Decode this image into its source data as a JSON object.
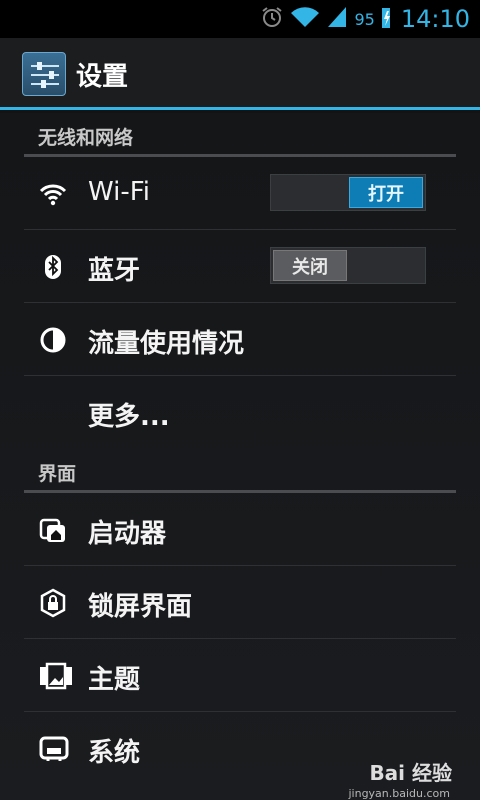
{
  "status_bar": {
    "battery": "95",
    "time": "14:10"
  },
  "action_bar": {
    "title": "设置"
  },
  "sections": [
    {
      "label": "无线和网络",
      "items": [
        {
          "label": "Wi-Fi",
          "icon": "wifi-icon",
          "toggle": "打开",
          "toggle_state": "on"
        },
        {
          "label": "蓝牙",
          "icon": "bluetooth-icon",
          "toggle": "关闭",
          "toggle_state": "off"
        },
        {
          "label": "流量使用情况",
          "icon": "data-usage-icon"
        },
        {
          "label": "更多...",
          "icon": ""
        }
      ]
    },
    {
      "label": "界面",
      "items": [
        {
          "label": "启动器",
          "icon": "launcher-icon"
        },
        {
          "label": "锁屏界面",
          "icon": "lockscreen-icon"
        },
        {
          "label": "主题",
          "icon": "theme-icon"
        },
        {
          "label": "系统",
          "icon": "system-icon"
        }
      ]
    }
  ],
  "watermark": {
    "text": "Bai 经验",
    "sub": "jingyan.baidu.com"
  },
  "colors": {
    "accent": "#33b5e5",
    "toggle_on": "#0e7db5"
  }
}
